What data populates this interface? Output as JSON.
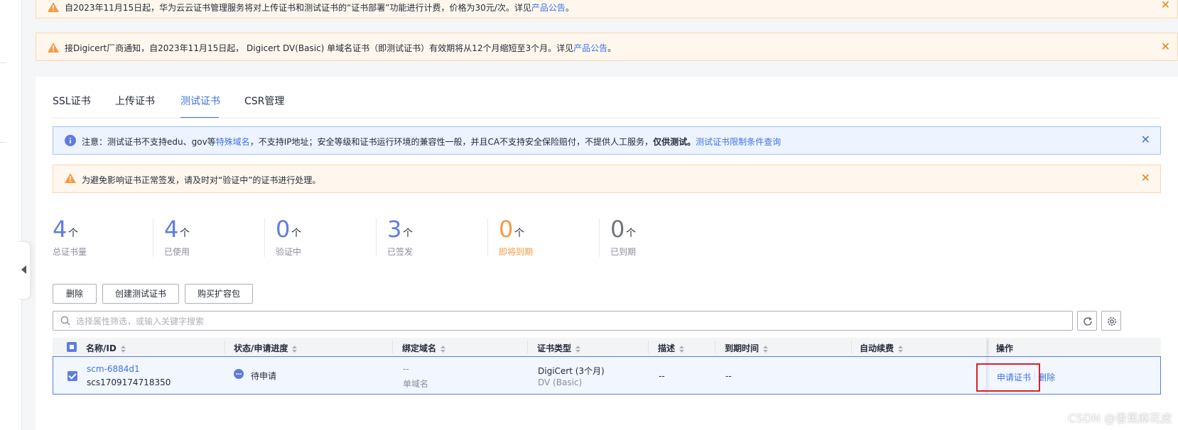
{
  "banners": [
    {
      "text": "自2023年11月15日起，华为云云证书管理服务将对上传证书和测试证书的“证书部署”功能进行计费，价格为30元/次。详见",
      "link": "产品公告",
      "suffix": "。"
    },
    {
      "text": "接Digicert厂商通知，自2023年11月15日起， Digicert DV(Basic) 单域名证书（即测试证书）有效期将从12个月缩短至3个月。详见",
      "link": "产品公告",
      "suffix": "。"
    }
  ],
  "tabs": [
    {
      "label": "SSL证书"
    },
    {
      "label": "上传证书"
    },
    {
      "label": "测试证书"
    },
    {
      "label": "CSR管理"
    }
  ],
  "active_tab": "测试证书",
  "alerts": {
    "info": {
      "text1": "注意：测试证书不支持edu、gov等",
      "link1": "特殊域名",
      "text2": "，不支持IP地址；安全等级和证书运行环境的兼容性一般，并且CA不支持安全保险赔付，不提供人工服务，",
      "bold": "仅供测试。",
      "link2": "测试证书限制条件查询"
    },
    "warn": {
      "text": "为避免影响证书正常签发，请及时对“验证中”的证书进行处理。"
    }
  },
  "stats": [
    {
      "value": "4",
      "unit": "个",
      "label": "总证书量"
    },
    {
      "value": "4",
      "unit": "个",
      "label": "已使用"
    },
    {
      "value": "0",
      "unit": "个",
      "label": "验证中"
    },
    {
      "value": "3",
      "unit": "个",
      "label": "已签发"
    },
    {
      "value": "0",
      "unit": "个",
      "label": "即将到期"
    },
    {
      "value": "0",
      "unit": "个",
      "label": "已到期"
    }
  ],
  "buttons": {
    "delete": "删除",
    "create_test_cert": "创建测试证书",
    "buy_expansion": "购买扩容包"
  },
  "search": {
    "placeholder": "选择属性筛选，或输入关键字搜索"
  },
  "table": {
    "columns": {
      "name_id": "名称/ID",
      "status": "状态/申请进度",
      "domain": "绑定域名",
      "cert_type": "证书类型",
      "description": "描述",
      "expiry": "到期时间",
      "auto_renew": "自动续费",
      "actions": "操作"
    },
    "rows": [
      {
        "name": "scm-6884d1",
        "id": "scs1709174718350",
        "status": "待申请",
        "domain": "--",
        "domain_type": "单域名",
        "cert_type": "DigiCert (3个月)",
        "cert_subtype": "DV (Basic)",
        "description": "--",
        "expiry": "--",
        "auto_renew": "",
        "action_apply": "申请证书",
        "action_delete": "删除"
      }
    ]
  },
  "watermark": "CSDN @香蕉麻花皮",
  "colors": {
    "accent": "#5e7ce0",
    "link": "#3d73e6",
    "warning": "#fa9841",
    "highlight": "#e02020"
  }
}
